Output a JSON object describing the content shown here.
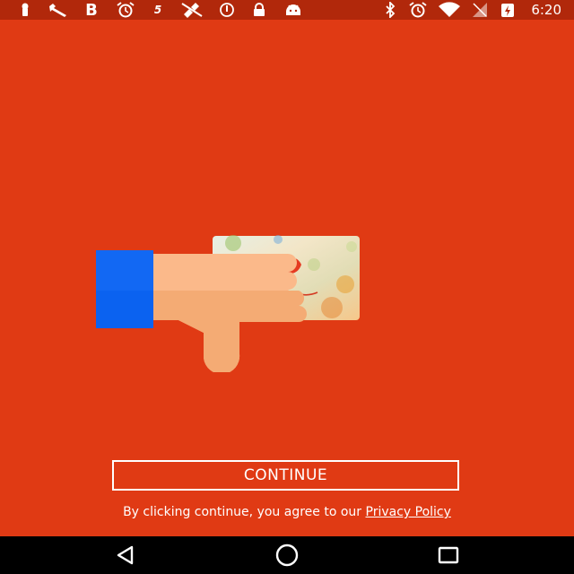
{
  "status_bar": {
    "time": "6:20",
    "icons": [
      "notification-icon",
      "wrench-icon",
      "bold-b-icon",
      "alarm-icon",
      "five-icon",
      "satellite-icon",
      "sync-off-icon",
      "lock-icon",
      "android-icon",
      "bluetooth-icon",
      "alarm-icon",
      "wifi-icon",
      "no-signal-icon",
      "battery-charging-icon"
    ]
  },
  "colors": {
    "background": "#e03a14",
    "status_bar": "#b1280b",
    "sleeve": "#1268f3",
    "skin": "#fbb98a"
  },
  "main": {
    "continue_label": "CONTINUE",
    "consent_text": "By clicking continue, you agree to our ",
    "privacy_link": "Privacy Policy"
  },
  "nav_bar": {
    "buttons": [
      "back-icon",
      "home-icon",
      "recents-icon"
    ]
  }
}
